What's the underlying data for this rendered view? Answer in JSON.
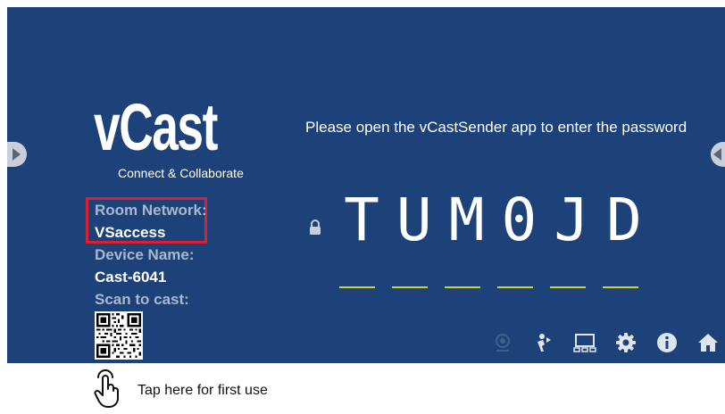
{
  "logo": {
    "name": "vCast",
    "tagline": "Connect & Collaborate"
  },
  "device_info": {
    "room_network_label": "Room Network:",
    "room_network_value": "VSaccess",
    "device_name_label": "Device Name:",
    "device_name_value": "Cast-6041",
    "scan_label": "Scan to cast:"
  },
  "password_panel": {
    "prompt": "Please open the vCastSender app to enter the password",
    "code": [
      "T",
      "U",
      "M",
      "0",
      "J",
      "D"
    ]
  },
  "toolbar": {
    "icons": [
      "screen-share-icon",
      "user-control-icon",
      "devices-icon",
      "gear-icon",
      "info-icon",
      "home-icon"
    ]
  },
  "first_use": {
    "label": "Tap here for first use"
  },
  "colors": {
    "background": "#1d4279",
    "accent": "#c9d42a",
    "highlight": "#d8202f"
  }
}
